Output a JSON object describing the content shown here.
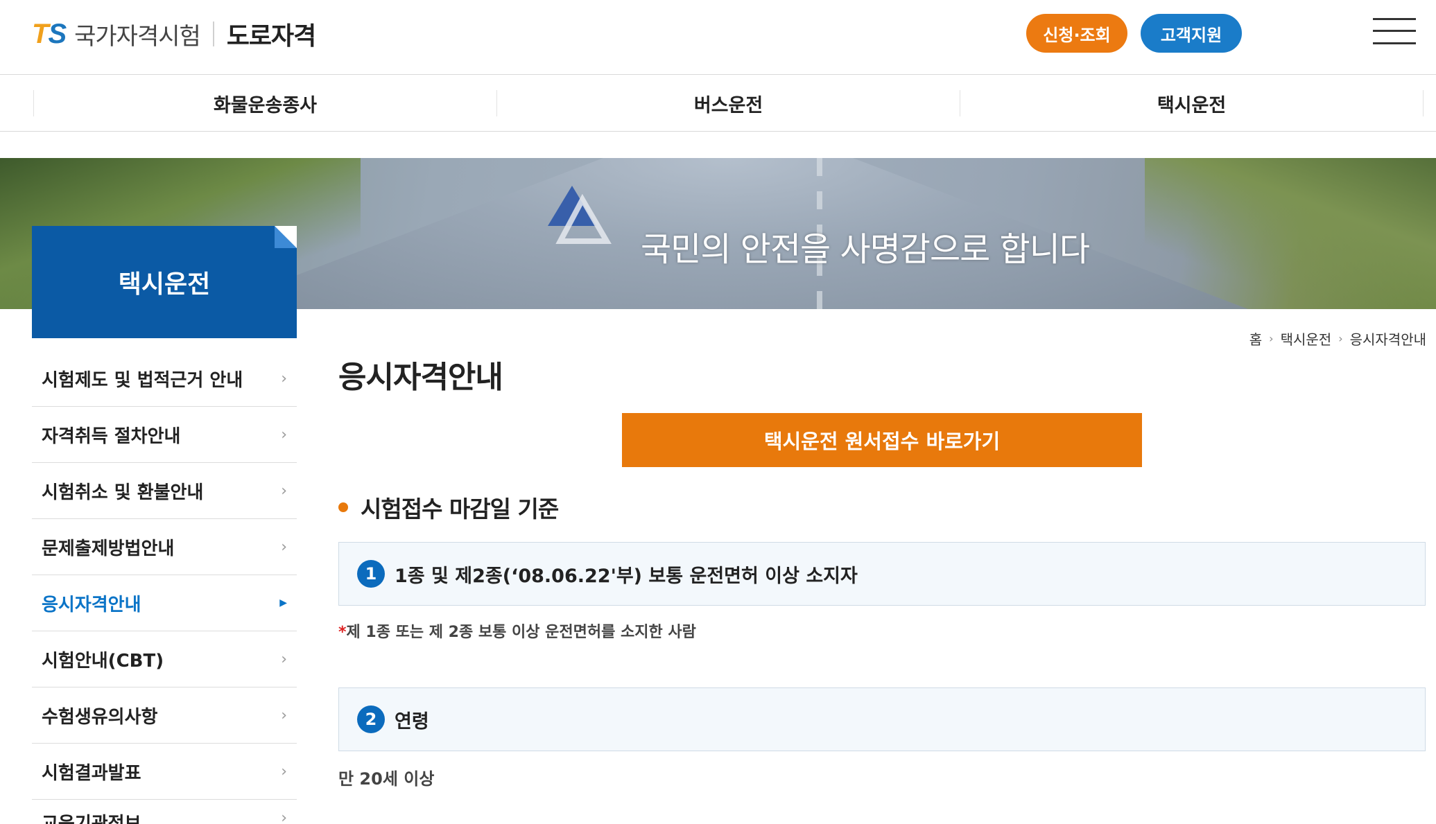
{
  "header": {
    "logo_mark": "TS",
    "logo_name": "국가자격시험",
    "logo_sub": "도로자격",
    "apply_button": "신청·조회",
    "support_button": "고객지원"
  },
  "nav": {
    "items": [
      "화물운송종사",
      "버스운전",
      "택시운전"
    ]
  },
  "banner": {
    "slogan": "국민의 안전을 사명감으로 합니다"
  },
  "sidebar": {
    "title": "택시운전",
    "items": [
      {
        "label": "시험제도 및 법적근거 안내"
      },
      {
        "label": "자격취득 절차안내"
      },
      {
        "label": "시험취소 및 환불안내"
      },
      {
        "label": "문제출제방법안내"
      },
      {
        "label": "응시자격안내",
        "active": true
      },
      {
        "label": "시험안내(CBT)"
      },
      {
        "label": "수험생유의사항"
      },
      {
        "label": "시험결과발표"
      },
      {
        "label": "교육기관정보"
      }
    ]
  },
  "breadcrumb": [
    "홈",
    "택시운전",
    "응시자격안내"
  ],
  "main": {
    "title": "응시자격안내",
    "go_button": "택시운전 원서접수 바로가기",
    "section_title": "시험접수 마감일 기준",
    "criteria": [
      {
        "num": "1",
        "text": "1종 및 제2종(‘08.06.22'부) 보통 운전면허 이상 소지자",
        "note_star": "*",
        "note": "제 1종 또는 제 2종 보통 이상 운전면허를 소지한 사람"
      },
      {
        "num": "2",
        "text": "연령",
        "desc": "만 20세 이상"
      }
    ]
  },
  "colors": {
    "orange": "#e8790c",
    "blue": "#0b5aa5",
    "active_blue": "#0b74c7"
  }
}
